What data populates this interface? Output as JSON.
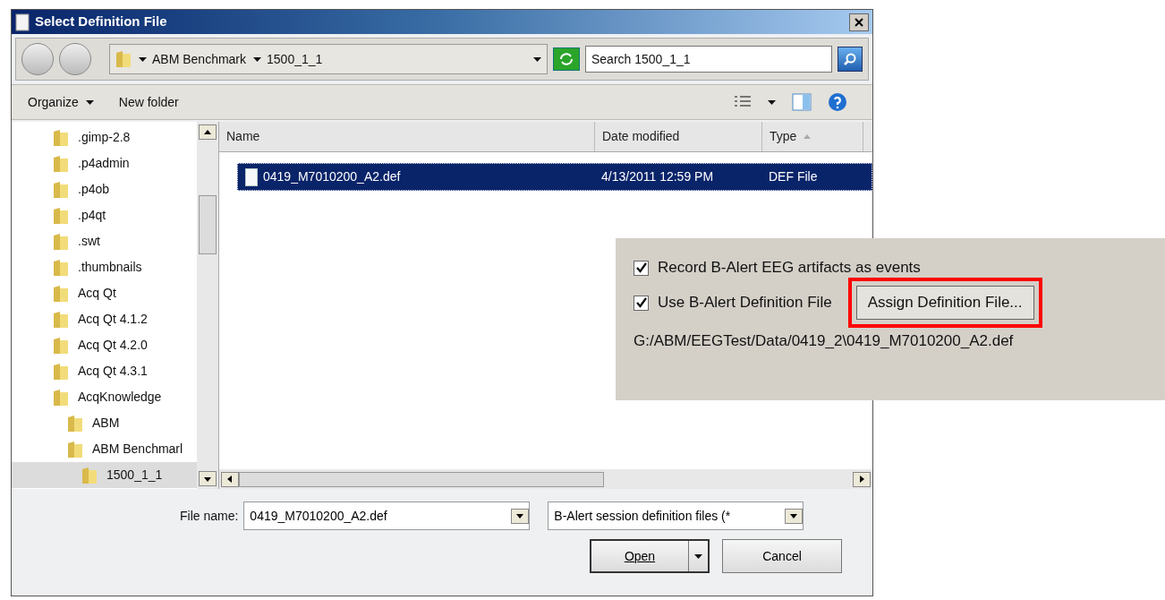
{
  "window": {
    "title": "Select Definition File"
  },
  "address_bar": {
    "path": [
      {
        "label": "ABM Benchmark"
      },
      {
        "label": "1500_1_1"
      }
    ]
  },
  "search": {
    "placeholder": "Search 1500_1_1"
  },
  "toolbar": {
    "items": [
      {
        "label": "Organize",
        "has_menu": true
      },
      {
        "label": "New folder",
        "has_menu": false
      }
    ]
  },
  "tree": {
    "items": [
      {
        "label": ".gimp-2.8",
        "selected": false
      },
      {
        "label": ".p4admin",
        "selected": false
      },
      {
        "label": ".p4ob",
        "selected": false
      },
      {
        "label": ".p4qt",
        "selected": false
      },
      {
        "label": ".swt",
        "selected": false
      },
      {
        "label": ".thumbnails",
        "selected": false
      },
      {
        "label": "Acq Qt",
        "selected": false
      },
      {
        "label": "Acq Qt 4.1.2",
        "selected": false
      },
      {
        "label": "Acq Qt 4.2.0",
        "selected": false
      },
      {
        "label": "Acq Qt 4.3.1",
        "selected": false
      },
      {
        "label": "AcqKnowledge",
        "selected": false,
        "children": [
          {
            "label": "ABM",
            "selected": false
          },
          {
            "label": "ABM Benchmarl",
            "selected": false,
            "children": [
              {
                "label": "1500_1_1",
                "selected": true
              }
            ]
          }
        ]
      }
    ]
  },
  "table": {
    "columns": [
      {
        "label": "Name",
        "sorted": false
      },
      {
        "label": "Date modified",
        "sorted": false
      },
      {
        "label": "Type",
        "sorted": true
      }
    ],
    "rows": [
      {
        "name": "0419_M7010200_A2.def",
        "date": "4/13/2011 12:59 PM",
        "type": "DEF File",
        "selected": true
      }
    ]
  },
  "file_name": {
    "label": "File name:",
    "value": "0419_M7010200_A2.def"
  },
  "file_type": {
    "value": "B-Alert session definition files (*"
  },
  "buttons": [
    {
      "label": "Open",
      "kind": "split"
    },
    {
      "label": "Cancel",
      "kind": "plain"
    }
  ],
  "overlay_panel": {
    "checkboxes": [
      {
        "label": "Record B-Alert EEG artifacts as events",
        "checked": true
      },
      {
        "label": "Use B-Alert Definition File",
        "checked": true
      }
    ],
    "assign_button": {
      "label": "Assign Definition File...",
      "highlighted": true
    },
    "path": "G:/ABM/EEGTest/Data/0419_2\\0419_M7010200_A2.def"
  }
}
